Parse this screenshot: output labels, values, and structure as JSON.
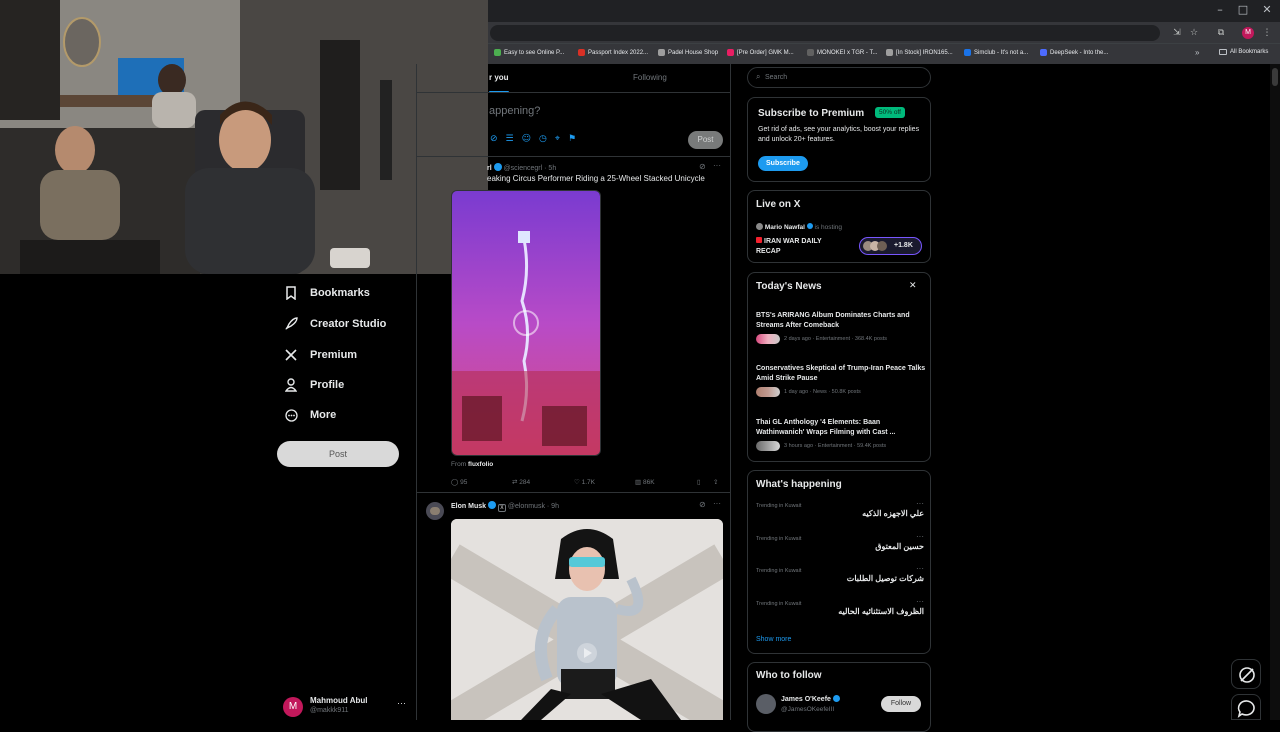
{
  "bookmarks_bar": {
    "items": [
      {
        "label": "Easy to see Online P...",
        "color": "#4caf50"
      },
      {
        "label": "Passport Index 2022...",
        "color": "#d93025"
      },
      {
        "label": "Padel House Shop",
        "color": "#9e9e9e"
      },
      {
        "label": "[Pre Order] GMK M...",
        "color": "#e91e63"
      },
      {
        "label": "MONOKEI x TGR - T...",
        "color": "#616161"
      },
      {
        "label": "[In Stock] IRON165...",
        "color": "#9e9e9e"
      },
      {
        "label": "Simclub - It's not a...",
        "color": "#1a73e8"
      },
      {
        "label": "DeepSeek - Into the...",
        "color": "#4d6bfe"
      }
    ],
    "all_bookmarks": "All Bookmarks"
  },
  "nav": {
    "bookmarks": "Bookmarks",
    "creator_studio": "Creator Studio",
    "premium": "Premium",
    "profile": "Profile",
    "more": "More",
    "post": "Post"
  },
  "account": {
    "avatar_letter": "M",
    "name": "Mahmoud Abul",
    "handle": "@makkk911",
    "more": "···"
  },
  "feed": {
    "tabs": {
      "for_you": "r you",
      "following": "Following"
    },
    "composer": {
      "placeholder": "appening?",
      "post": "Post"
    },
    "tweet1": {
      "name": "rl",
      "handle": "@sciencegrl",
      "time": "· 5h",
      "text": "eaking Circus Performer Riding a 25-Wheel Stacked Unicycle",
      "from_label": "From",
      "from_source": "fluxfolio",
      "replies": "95",
      "reposts": "284",
      "likes": "1.7K",
      "views": "86K"
    },
    "tweet2": {
      "name": "Elon Musk",
      "handle": "@elonmusk",
      "time": "· 9h"
    }
  },
  "right": {
    "search_placeholder": "Search",
    "premium": {
      "title": "Subscribe to Premium",
      "badge": "50% off",
      "text": "Get rid of ads, see your analytics, boost your replies and unlock 20+ features.",
      "button": "Subscribe"
    },
    "live": {
      "title": "Live on X",
      "host": "Mario Nawfal",
      "hosting": "is hosting",
      "show": "IRAN WAR DAILY RECAP",
      "listeners": "+1.8K"
    },
    "news": {
      "title": "Today's News",
      "items": [
        {
          "title": "BTS's ARIRANG Album Dominates Charts and Streams After Comeback",
          "meta": "2 days ago · Entertainment · 368.4K posts"
        },
        {
          "title": "Conservatives Skeptical of Trump-Iran Peace Talks Amid Strike Pause",
          "meta": "1 day ago · News · 50.8K posts"
        },
        {
          "title": "Thai GL Anthology '4 Elements: Baan Wathinwanich' Wraps Filming with Cast ...",
          "meta": "3 hours ago · Entertainment · 59.4K posts"
        }
      ]
    },
    "happening": {
      "title": "What's happening",
      "items": [
        {
          "label": "Trending in Kuwait",
          "topic": "علي الاجهزه الذكيه"
        },
        {
          "label": "Trending in Kuwait",
          "topic": "حسين المعتوق"
        },
        {
          "label": "Trending in Kuwait",
          "topic": "شركات توصيل الطلبات"
        },
        {
          "label": "Trending in Kuwait",
          "topic": "الظروف الاستثنائيه الحاليه"
        }
      ],
      "show_more": "Show more"
    },
    "who_to_follow": {
      "title": "Who to follow",
      "name": "James O'Keefe",
      "handle": "@JamesOKeefeIII",
      "button": "Follow"
    }
  },
  "colors": {
    "accent": "#1d9bf0",
    "premium_badge": "#00ba7c",
    "verified": "#1d9bf0"
  }
}
